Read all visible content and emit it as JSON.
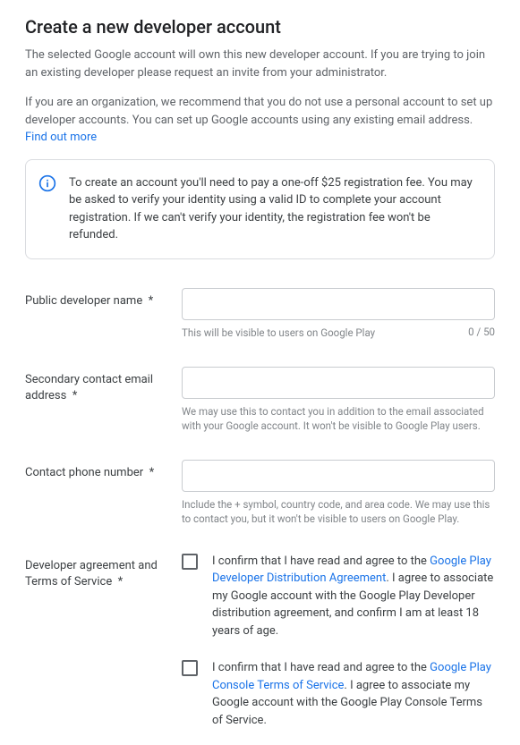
{
  "title": "Create a new developer account",
  "intro1": "The selected Google account will own this new developer account. If you are trying to join an existing developer please request an invite from your administrator.",
  "intro2_a": "If you are an organization, we recommend that you do not use a personal account to set up developer accounts. You can set up Google accounts using any existing email address. ",
  "intro2_link": "Find out more",
  "info_text": "To create an account you'll need to pay a one-off $25 registration fee. You may be asked to verify your identity using a valid ID to complete your account registration. If we can't verify your identity, the registration fee won't be refunded.",
  "fields": {
    "devname": {
      "label": "Public developer name  *",
      "helper": "This will be visible to users on Google Play",
      "counter": "0 / 50"
    },
    "email": {
      "label": "Secondary contact email address  *",
      "helper": "We may use this to contact you in addition to the email associated with your Google account. It won't be visible to Google Play users."
    },
    "phone": {
      "label": "Contact phone number  *",
      "helper": "Include the + symbol, country code, and area code. We may use this to contact you, but it won't be visible to users on Google Play."
    },
    "agreements": {
      "label": "Developer agreement and Terms of Service  *",
      "check1_a": "I confirm that I have read and agree to the ",
      "check1_link": "Google Play Developer Distribution Agreement",
      "check1_b": ". I agree to associate my Google account with the Google Play Developer distribution agreement, and confirm I am at least 18 years of age.",
      "check2_a": "I confirm that I have read and agree to the ",
      "check2_link": "Google Play Console Terms of Service",
      "check2_b": ". I agree to associate my Google account with the Google Play Console Terms of Service."
    }
  }
}
